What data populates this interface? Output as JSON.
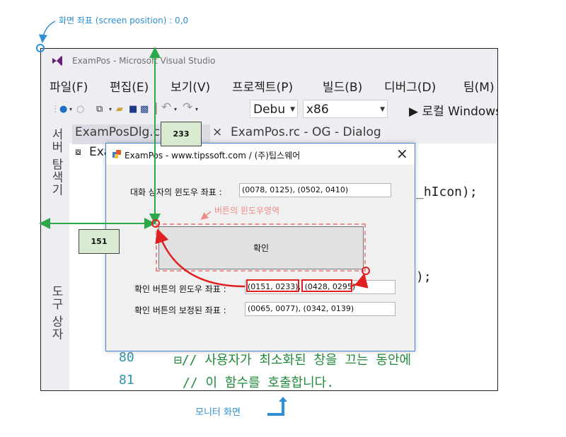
{
  "annotations": {
    "screen_origin": "화면 좌표 (screen position) : 0,0",
    "top_tag": "233",
    "left_tag": "151",
    "button_area_label": "버튼의 윈도우영역",
    "monitor_label": "모니터 화면"
  },
  "vs": {
    "title": "ExamPos - Microsoft Visual Studio",
    "menu": [
      "파일(F)",
      "편집(E)",
      "보기(V)",
      "프로젝트(P)",
      "빌드(B)",
      "디버그(D)",
      "팀(M)"
    ],
    "config_combo": "Debu",
    "platform_combo": "x86",
    "run_target": "▶ 로컬 Windows",
    "side_tabs": [
      "서버 탐색기",
      "도구 상자"
    ],
    "doc_tabs": [
      "ExamPosDlg.c",
      "×",
      "ExamPos.rc - OG - Dialog"
    ],
    "code_nav": "Exa",
    "code_fragments": [
      "_hIcon);",
      ");"
    ],
    "lines": [
      {
        "num": "80",
        "text": "⊟// 사용자가 최소화된 창을 끄는 동안에"
      },
      {
        "num": "81",
        "text": "//   이 함수를 호출합니다."
      }
    ]
  },
  "dialog": {
    "title": "ExamPos - www.tipssoft.com / (주)팁스웨어",
    "close": "×",
    "rows": [
      {
        "label": "대화 상자의 윈도우 좌표 :",
        "value": "(0078, 0125), (0502, 0410)"
      },
      {
        "label": "확인 버튼의 윈도우 좌표 :",
        "value_part1": "(0151, 0233)",
        "value_sep": ",",
        "value_part2": "(0428, 0295)"
      },
      {
        "label": "확인 버튼의 보정된 좌표 :",
        "value": "(0065, 0077), (0342, 0139)"
      }
    ],
    "ok_button": "확인"
  },
  "colors": {
    "annotation_blue": "#2f8fd6",
    "annotation_green": "#2aa84a",
    "highlight_red": "#e02020",
    "tag_fill": "#d9ead3"
  }
}
